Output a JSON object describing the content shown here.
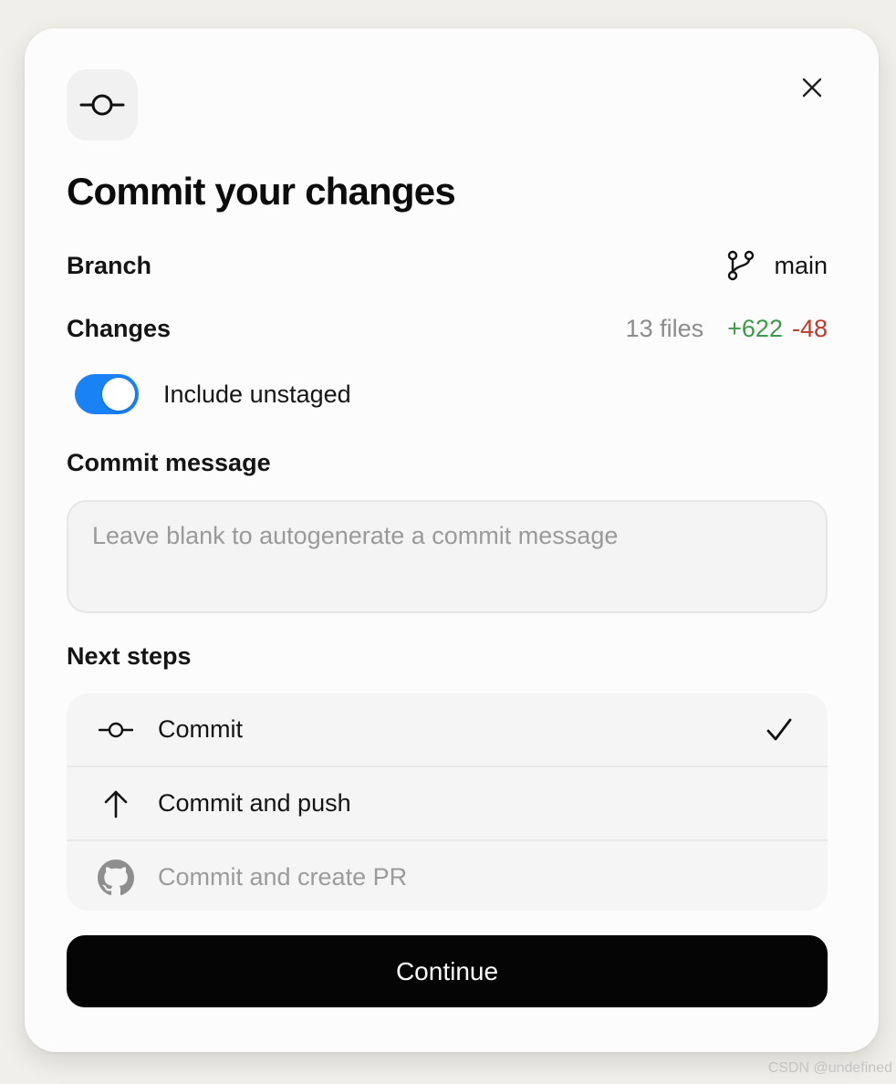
{
  "dialog": {
    "title": "Commit your changes"
  },
  "branch": {
    "label": "Branch",
    "value": "main"
  },
  "changes": {
    "label": "Changes",
    "files": "13 files",
    "additions": "+622",
    "deletions": "-48"
  },
  "toggle": {
    "label": "Include unstaged",
    "checked": true
  },
  "commit_message": {
    "label": "Commit message",
    "placeholder": "Leave blank to autogenerate a commit message",
    "value": ""
  },
  "next_steps": {
    "label": "Next steps",
    "options": [
      {
        "label": "Commit",
        "icon": "commit-icon",
        "selected": true,
        "disabled": false
      },
      {
        "label": "Commit and push",
        "icon": "arrow-up-icon",
        "selected": false,
        "disabled": false
      },
      {
        "label": "Commit and create PR",
        "icon": "github-icon",
        "selected": false,
        "disabled": true
      }
    ]
  },
  "actions": {
    "continue_label": "Continue"
  },
  "watermark": "CSDN @undefined",
  "colors": {
    "toggle_on": "#1a82f7",
    "additions": "#3d9a4a",
    "deletions": "#c0392b",
    "primary_button": "#050505"
  }
}
